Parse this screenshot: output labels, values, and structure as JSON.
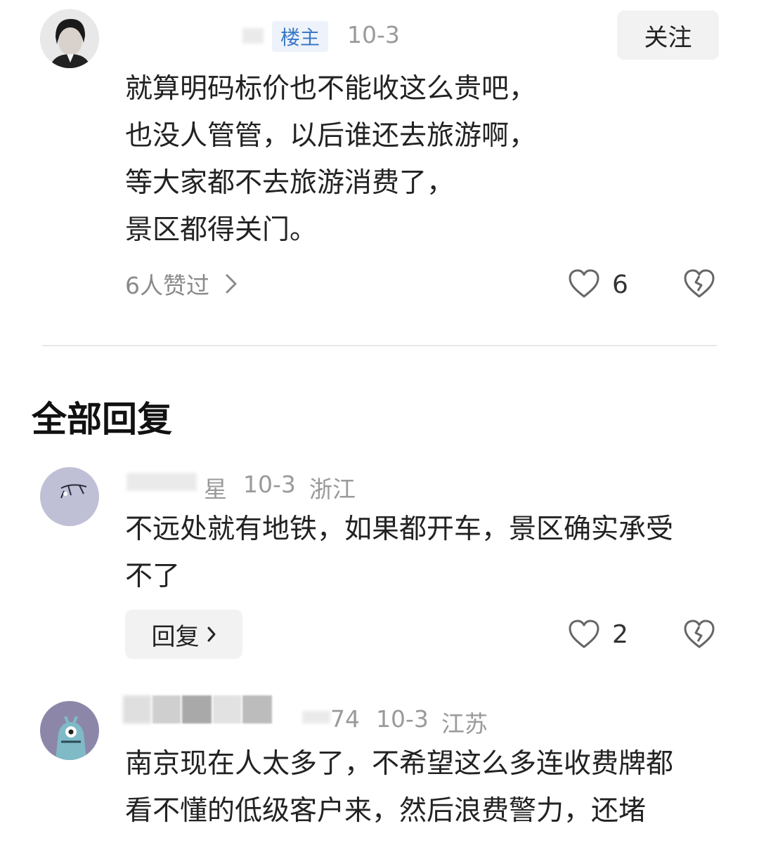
{
  "post": {
    "tag": "楼主",
    "date": "10-3",
    "follow_label": "关注",
    "lines": [
      "就算明码标价也不能收这么贵吧，",
      "也没人管管，以后谁还去旅游啊，",
      "等大家都不去旅游消费了，",
      "景区都得关门。"
    ],
    "likes_summary": "6人赞过",
    "like_count": "6"
  },
  "section_title": "全部回复",
  "replies": [
    {
      "name_fragment": "星",
      "date": "10-3",
      "location": "浙江",
      "lines": [
        "不远处就有地铁，如果都开车，景区确实承受",
        "不了"
      ],
      "reply_label": "回复",
      "like_count": "2"
    },
    {
      "name_fragment": "74",
      "date": "10-3",
      "location": "江苏",
      "lines": [
        "南京现在人太多了，不希望这么多连收费牌都",
        "看不懂的低级客户来，然后浪费警力，还堵"
      ]
    }
  ],
  "colors": {
    "accent": "#3a78c7",
    "muted": "#9a9a9a",
    "divider": "#e5e5e5"
  }
}
